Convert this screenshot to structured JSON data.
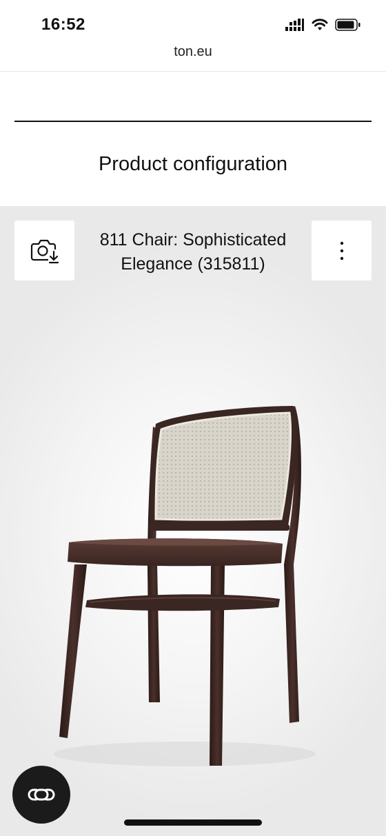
{
  "status_bar": {
    "time": "16:52"
  },
  "browser": {
    "url": "ton.eu"
  },
  "page": {
    "title": "Product configuration"
  },
  "viewer": {
    "product_name": "811 Chair: Sophisticated Elegance (315811)",
    "icons": {
      "snapshot": "camera-download-icon",
      "more": "vertical-ellipsis-icon",
      "ar": "augmented-reality-icon"
    }
  },
  "colors": {
    "wood": "#3a2622",
    "cane": "#d6d2c8",
    "accent_dark": "#1b1b1b"
  }
}
